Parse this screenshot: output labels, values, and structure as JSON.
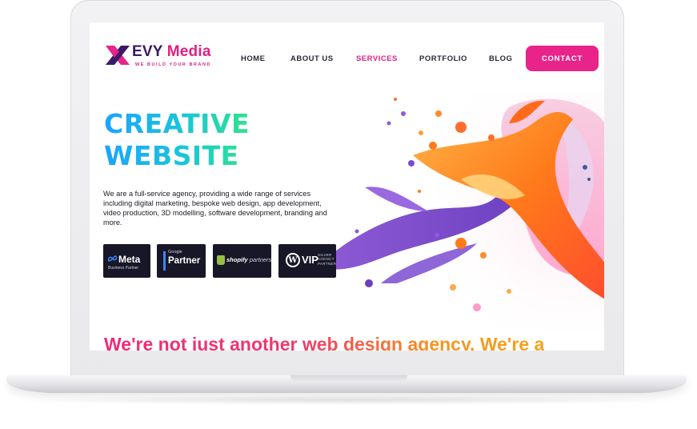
{
  "brand": {
    "prefix": "EVY",
    "name": "Media",
    "tagline": "WE BUILD YOUR BRAND",
    "colors": {
      "primary": "#e8238a",
      "dark": "#3a1a66",
      "ink": "#2a2a3a"
    }
  },
  "nav": {
    "items": [
      {
        "label": "HOME"
      },
      {
        "label": "ABOUT US"
      },
      {
        "label": "SERVICES",
        "active": true
      },
      {
        "label": "PORTFOLIO"
      },
      {
        "label": "BLOG"
      }
    ],
    "cta_label": "CONTACT"
  },
  "hero": {
    "title_line1": "CREATIVE",
    "title_line2": "WEBSITE",
    "description": "We are a full-service agency, providing a wide range of services including digital marketing, bespoke web design, app development, video production, 3D modelling, software development, branding and more."
  },
  "badges": {
    "meta": {
      "title": "Meta",
      "subtitle": "Business Partner"
    },
    "google": {
      "small": "Google",
      "title": "Partner"
    },
    "shopify": {
      "title": "shopify",
      "suffix": "partners"
    },
    "wordpress": {
      "title": "VIP",
      "subtitle_1": "SILVER",
      "subtitle_2": "AGENCY",
      "subtitle_3": "PARTNER"
    }
  },
  "section": {
    "heading": "We're not just another web design agency. We're a"
  }
}
